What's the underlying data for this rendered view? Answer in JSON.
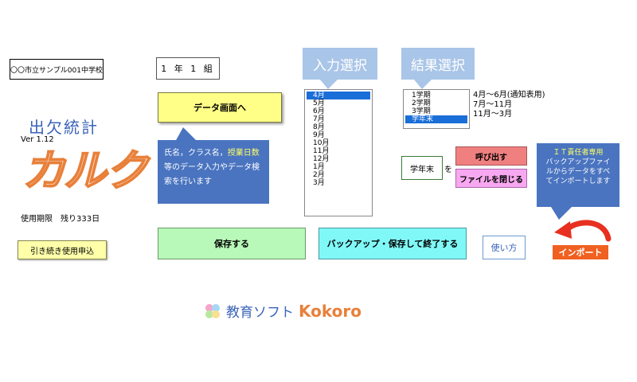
{
  "header": {
    "school_name": "〇〇市立サンプル001中学校",
    "class_label": "1 年 1 組"
  },
  "app": {
    "title": "出欠統計",
    "version": "Ver 1.12",
    "logo_text": "カルク",
    "usage_period": "使用期限　残り333日",
    "renew_label": "引き続き使用申込"
  },
  "data_screen": {
    "button_label": "データ画面へ",
    "callout_part1": "氏名，クラス名，",
    "callout_hl": "授業日数",
    "callout_part2": "等のデータ入力やデータ検索を行います"
  },
  "input_select": {
    "label": "入力選択",
    "months": [
      "4月",
      "5月",
      "6月",
      "7月",
      "8月",
      "9月",
      "10月",
      "11月",
      "12月",
      "1月",
      "2月",
      "3月"
    ],
    "selected_index": 0
  },
  "result_select": {
    "label": "結果選択",
    "terms": [
      "1学期",
      "2学期",
      "3学期",
      "学年末"
    ],
    "selected_index": 3,
    "descriptions": [
      "4月～6月(通知表用)",
      "7月～11月",
      "11月～3月"
    ],
    "field_value": "学年末",
    "particle": "を"
  },
  "actions": {
    "call_label": "呼び出す",
    "close_label": "ファイルを閉じる",
    "save_label": "保存する",
    "backup_label": "バックアップ・保存して終了する",
    "howto_label": "使い方",
    "import_label": "インポート"
  },
  "it_note": {
    "heading": "ＩＴ責任者専用",
    "body": "バックアップファイルからデータをすべてインポートします"
  },
  "brand": {
    "prefix": "教育ソフト",
    "name": "Kokoro"
  },
  "colors": {
    "accent_blue": "#4a74c0",
    "logo_orange": "#e8803a",
    "select_blue": "#1a6ed8"
  }
}
